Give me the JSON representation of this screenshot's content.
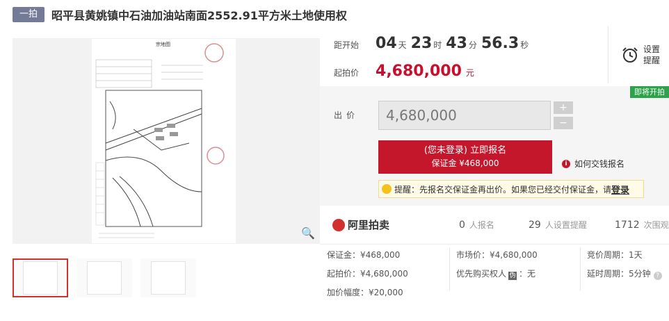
{
  "title": {
    "badge": "一拍",
    "text": "昭平县黄姚镇中石油加油站南面2552.91平方米土地使用权"
  },
  "countdown": {
    "label": "距开始",
    "days": "04",
    "days_unit": "天",
    "hours": "23",
    "hours_unit": "时",
    "minutes": "43",
    "minutes_unit": "分",
    "seconds": "56.3",
    "seconds_unit": "秒"
  },
  "reminder": {
    "line1": "设置",
    "line2": "提醒",
    "icon": "alarm-clock-icon"
  },
  "start_price": {
    "label": "起拍价",
    "value": "4,680,000",
    "unit": "元"
  },
  "bid": {
    "tag": "即将开拍",
    "label": "出价",
    "value": "4,680,000",
    "plus": "+",
    "minus": "−"
  },
  "signup": {
    "line1": "(您未登录) 立即报名",
    "line2": "保证金 ¥468,000"
  },
  "how_to_pay": "如何交钱报名",
  "notice": {
    "text": "提醒：先报名交保证金再出价。如果您已经交付保证金，请",
    "login": "登录"
  },
  "stats": {
    "brand": "阿里拍卖",
    "signups": "0",
    "signups_label": "人报名",
    "reminders": "29",
    "reminders_label": "人设置提醒",
    "views": "1712",
    "views_label": "次围观"
  },
  "details": {
    "deposit": "保证金：¥468,000",
    "market_price": "市场价：¥4,680,000",
    "cycle": "竞价周期：1天",
    "start_price": "起拍价：¥4,680,000",
    "priority_label": "优先购买权人",
    "priority_badge": "伪",
    "priority_value": "：无",
    "delay": "延时周期：5分钟",
    "increment": "加价幅度：¥20,000"
  },
  "doc": {
    "heading": "宗地图"
  },
  "colors": {
    "accent": "#c4172c",
    "badge": "#737b96",
    "green": "#2ca34a"
  }
}
